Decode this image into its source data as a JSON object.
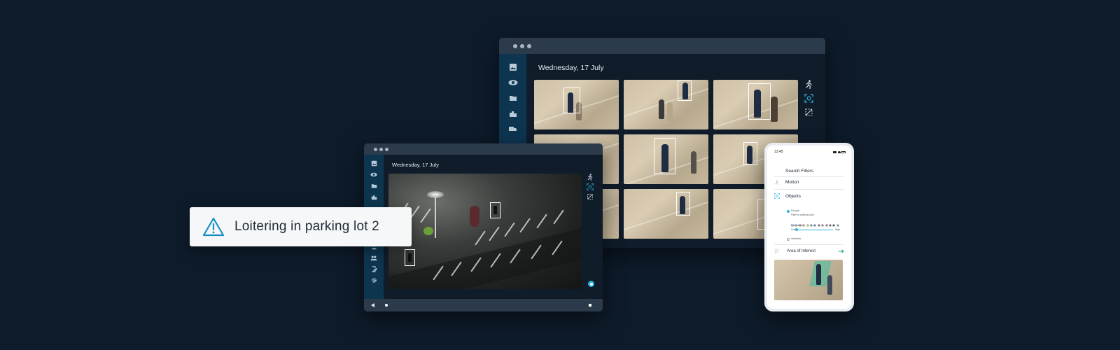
{
  "back_window": {
    "date": "Wednesday, 17 July",
    "sidebar_icons": [
      "images-icon",
      "eye-icon",
      "folder-icon",
      "building-icon",
      "truck-icon"
    ],
    "tools": [
      "motion-icon",
      "object-detect-icon",
      "area-of-interest-icon"
    ]
  },
  "front_window": {
    "date": "Wednesday, 17 July",
    "sidebar_icons": [
      "images-icon",
      "eye-icon",
      "folder-icon",
      "building-icon",
      "person-icon",
      "group-icon",
      "exit-icon",
      "gear-icon"
    ],
    "tools": [
      "motion-icon",
      "object-detect-icon",
      "area-of-interest-icon"
    ],
    "playback": [
      "play-back-icon",
      "timeline-dot",
      "stop-icon"
    ]
  },
  "alert": {
    "text": "Loitering in parking lot 2",
    "icon": "warning-icon",
    "accent_color": "#1a8fc4"
  },
  "phone": {
    "time": "13:45",
    "title": "Search Filters",
    "filters": {
      "motion": "Motion",
      "objects": "Objects",
      "people": "People",
      "filter_by_clothing_color": "Filter by clothing color",
      "resolution": "Resolution",
      "range_low": "Low",
      "range_high": "High",
      "vehicles": "Vehicles",
      "area_of_interest": "Area of Interest"
    },
    "clothing_colors": [
      "#ffffff",
      "#d9d9d9",
      "#c9a227",
      "#e07b1a",
      "#e5c642",
      "#2b8d6e",
      "#1c5f8a",
      "#6b3e8f",
      "#c0392b",
      "#a0522d",
      "#3b3b3b",
      "#111111",
      "#8a8a8a"
    ]
  },
  "colors": {
    "background": "#0e1b2a",
    "sidebar": "#0d3550",
    "accent": "#2bb3d9"
  }
}
